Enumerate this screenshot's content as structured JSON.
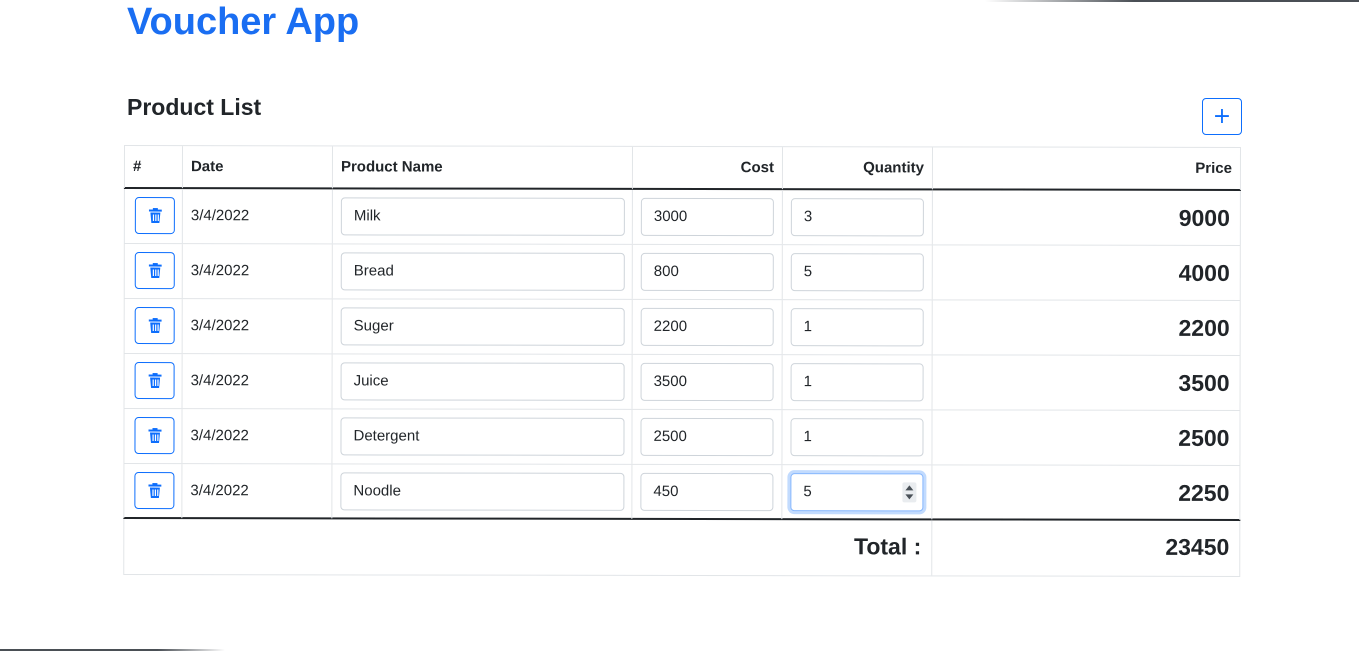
{
  "app": {
    "title": "Voucher App"
  },
  "product_list": {
    "title": "Product List",
    "add_label": "+"
  },
  "table": {
    "headers": {
      "index": "#",
      "date": "Date",
      "product_name": "Product Name",
      "cost": "Cost",
      "quantity": "Quantity",
      "price": "Price"
    },
    "rows": [
      {
        "date": "3/4/2022",
        "product_name": "Milk",
        "cost": "3000",
        "quantity": "3",
        "price": "9000"
      },
      {
        "date": "3/4/2022",
        "product_name": "Bread",
        "cost": "800",
        "quantity": "5",
        "price": "4000"
      },
      {
        "date": "3/4/2022",
        "product_name": "Suger",
        "cost": "2200",
        "quantity": "1",
        "price": "2200"
      },
      {
        "date": "3/4/2022",
        "product_name": "Juice",
        "cost": "3500",
        "quantity": "1",
        "price": "3500"
      },
      {
        "date": "3/4/2022",
        "product_name": "Detergent",
        "cost": "2500",
        "quantity": "1",
        "price": "2500"
      },
      {
        "date": "3/4/2022",
        "product_name": "Noodle",
        "cost": "450",
        "quantity": "5",
        "price": "2250"
      }
    ],
    "total_label": "Total :",
    "total_value": "23450"
  },
  "colors": {
    "brand": "#1a6ef2",
    "primary": "#0d6efd",
    "text": "#212529",
    "border": "#e2e5e8"
  },
  "icons": {
    "delete": "trash-icon",
    "add": "plus-icon"
  }
}
